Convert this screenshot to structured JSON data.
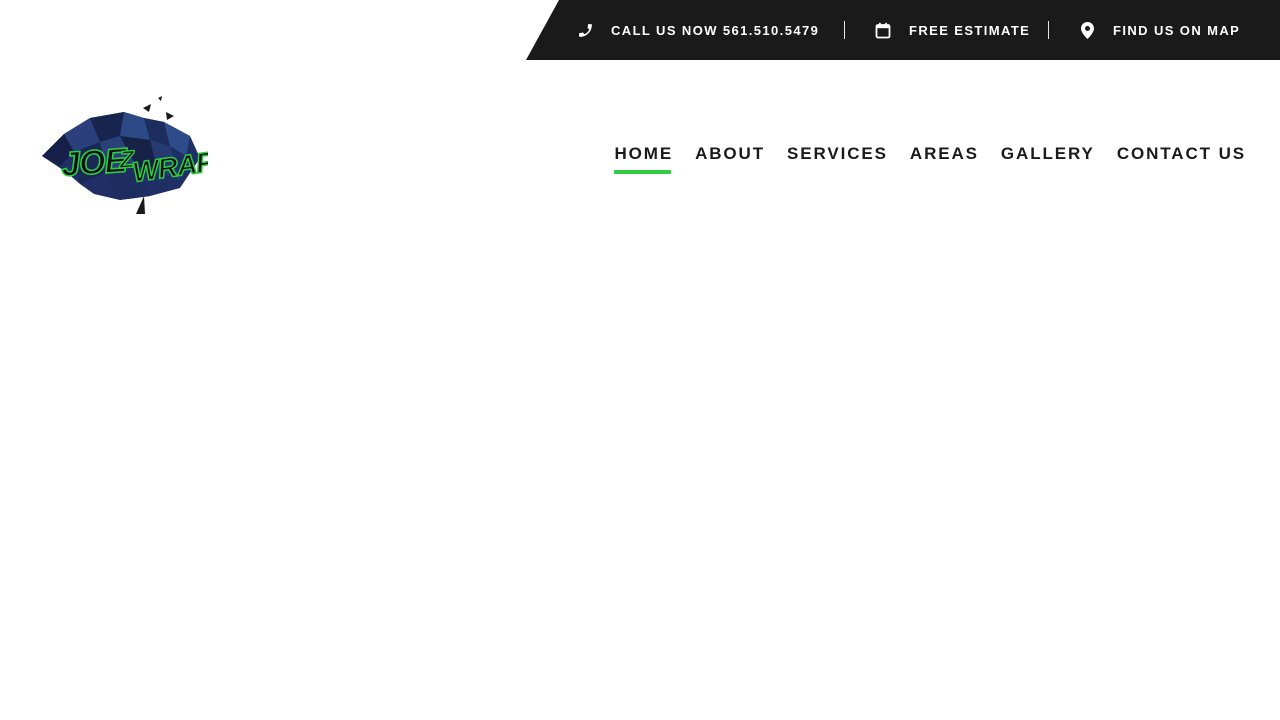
{
  "topbar": {
    "call": {
      "label": "CALL US NOW 561.510.5479",
      "icon": "phone-icon"
    },
    "estimate": {
      "label": "FREE ESTIMATE",
      "icon": "calendar-icon"
    },
    "map": {
      "label": "FIND US ON MAP",
      "icon": "map-pin-icon"
    }
  },
  "logo": {
    "text": "JOE Z WRAPS",
    "icon": "bear-logo-icon"
  },
  "nav": {
    "active_color": "#2ecc40",
    "items": [
      {
        "label": "HOME",
        "active": true
      },
      {
        "label": "ABOUT",
        "active": false
      },
      {
        "label": "SERVICES",
        "active": false
      },
      {
        "label": "AREAS",
        "active": false
      },
      {
        "label": "GALLERY",
        "active": false
      },
      {
        "label": "CONTACT US",
        "active": false
      }
    ]
  },
  "colors": {
    "topbar_bg": "#1a1a1a",
    "text_dark": "#1a1a1a",
    "accent": "#2ecc40"
  }
}
